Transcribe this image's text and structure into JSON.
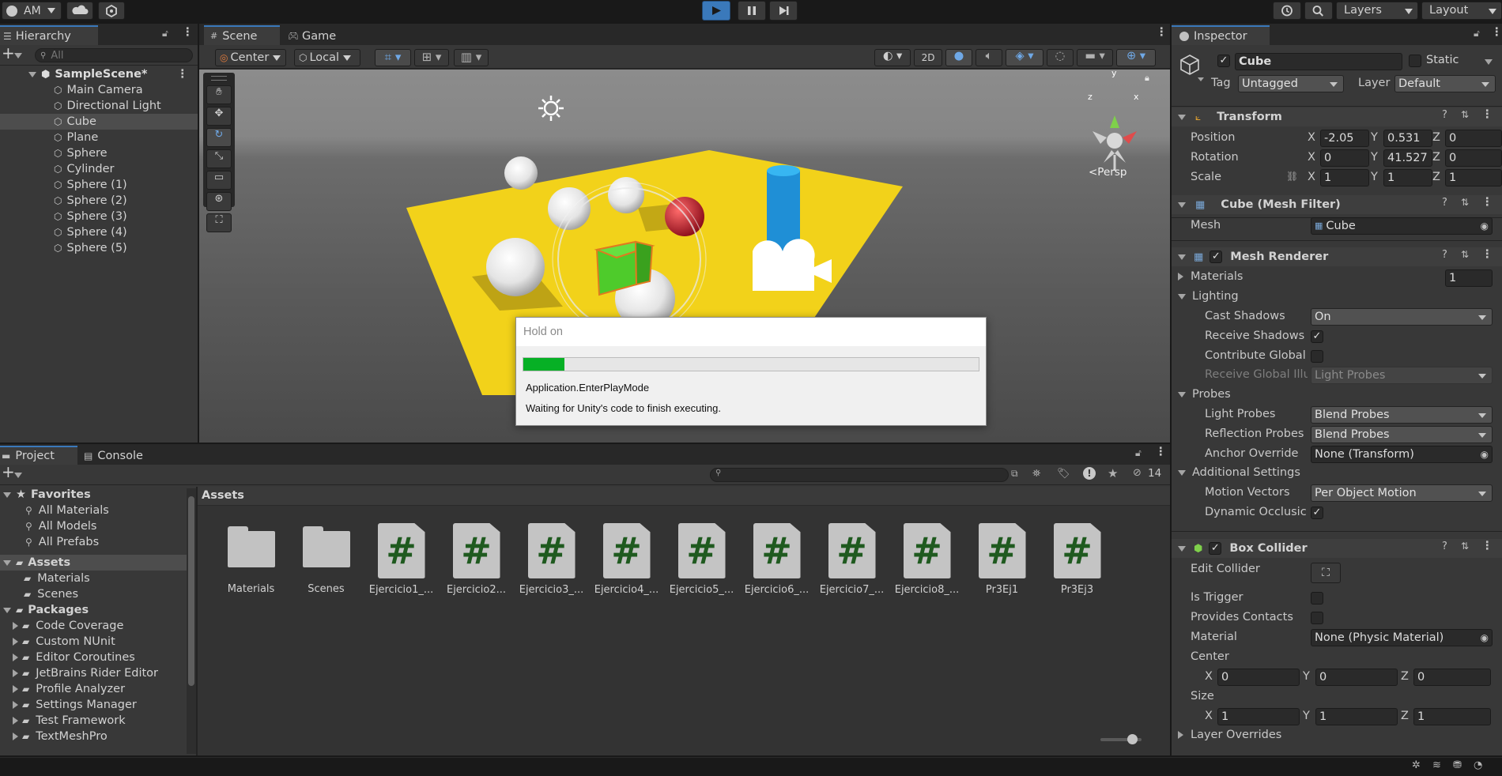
{
  "toolbar": {
    "account": "AM",
    "layers": "Layers",
    "layout": "Layout"
  },
  "hierarchy": {
    "tab": "Hierarchy",
    "search_placeholder": "All",
    "scene": "SampleScene*",
    "items": [
      "Main Camera",
      "Directional Light",
      "Cube",
      "Plane",
      "Sphere",
      "Cylinder",
      "Sphere (1)",
      "Sphere (2)",
      "Sphere (3)",
      "Sphere (4)",
      "Sphere (5)"
    ],
    "selected": "Cube"
  },
  "scene": {
    "tabs": [
      "Scene",
      "Game"
    ],
    "pivot": "Center",
    "space": "Local",
    "mode_2d": "2D",
    "persp": "<Persp",
    "gizmo_axes": {
      "y": "y",
      "x": "x",
      "z": "z"
    }
  },
  "dialog": {
    "title": "Hold on",
    "progress": 0.09,
    "line1": "Application.EnterPlayMode",
    "line2": "Waiting for Unity's code to finish executing."
  },
  "project": {
    "tabs": [
      "Project",
      "Console"
    ],
    "favorites_label": "Favorites",
    "favorites": [
      "All Materials",
      "All Models",
      "All Prefabs"
    ],
    "assets_label": "Assets",
    "assets_children": [
      "Materials",
      "Scenes"
    ],
    "packages_label": "Packages",
    "packages": [
      "Code Coverage",
      "Custom NUnit",
      "Editor Coroutines",
      "JetBrains Rider Editor",
      "Profile Analyzer",
      "Settings Manager",
      "Test Framework",
      "TextMeshPro"
    ],
    "breadcrumb": "Assets",
    "hidden_count": "14",
    "files": [
      {
        "name": "Materials",
        "type": "folder"
      },
      {
        "name": "Scenes",
        "type": "folder"
      },
      {
        "name": "Ejercicio1_...",
        "type": "script"
      },
      {
        "name": "Ejercicio2...",
        "type": "script"
      },
      {
        "name": "Ejercicio3_...",
        "type": "script"
      },
      {
        "name": "Ejercicio4_...",
        "type": "script"
      },
      {
        "name": "Ejercicio5_...",
        "type": "script"
      },
      {
        "name": "Ejercicio6_...",
        "type": "script"
      },
      {
        "name": "Ejercicio7_...",
        "type": "script"
      },
      {
        "name": "Ejercicio8_...",
        "type": "script"
      },
      {
        "name": "Pr3Ej1",
        "type": "script"
      },
      {
        "name": "Pr3Ej3",
        "type": "script"
      }
    ]
  },
  "inspector": {
    "tab": "Inspector",
    "object_name": "Cube",
    "static_label": "Static",
    "tag_label": "Tag",
    "tag_value": "Untagged",
    "layer_label": "Layer",
    "layer_value": "Default",
    "transform": {
      "title": "Transform",
      "position_label": "Position",
      "rotation_label": "Rotation",
      "scale_label": "Scale",
      "position": {
        "x": "-2.05",
        "y": "0.531",
        "z": "0"
      },
      "rotation": {
        "x": "0",
        "y": "41.527",
        "z": "0"
      },
      "scale": {
        "x": "1",
        "y": "1",
        "z": "1"
      }
    },
    "mesh_filter": {
      "title": "Cube (Mesh Filter)",
      "mesh_label": "Mesh",
      "mesh_value": "Cube"
    },
    "mesh_renderer": {
      "title": "Mesh Renderer",
      "materials_label": "Materials",
      "materials_count": "1",
      "lighting_label": "Lighting",
      "cast_shadows_label": "Cast Shadows",
      "cast_shadows_value": "On",
      "receive_shadows_label": "Receive Shadows",
      "contribute_gi_label": "Contribute Global",
      "receive_gi_label": "Receive Global Illu",
      "receive_gi_value": "Light Probes",
      "probes_label": "Probes",
      "light_probes_label": "Light Probes",
      "light_probes_value": "Blend Probes",
      "reflection_probes_label": "Reflection Probes",
      "reflection_probes_value": "Blend Probes",
      "anchor_label": "Anchor Override",
      "anchor_value": "None (Transform)",
      "additional_label": "Additional Settings",
      "motion_vectors_label": "Motion Vectors",
      "motion_vectors_value": "Per Object Motion",
      "dynamic_occlusion_label": "Dynamic Occlusic"
    },
    "box_collider": {
      "title": "Box Collider",
      "edit_collider_label": "Edit Collider",
      "is_trigger_label": "Is Trigger",
      "provides_contacts_label": "Provides Contacts",
      "material_label": "Material",
      "material_value": "None (Physic Material)",
      "center_label": "Center",
      "center": {
        "x": "0",
        "y": "0",
        "z": "0"
      },
      "size_label": "Size",
      "size": {
        "x": "1",
        "y": "1",
        "z": "1"
      },
      "layer_overrides_label": "Layer Overrides"
    }
  },
  "colors": {
    "toolbar_bg": "#191919",
    "panel_bg": "#383838",
    "selected_row": "#4d4d4d",
    "accent_blue": "#3a79bb",
    "progress_green": "#06b025"
  }
}
